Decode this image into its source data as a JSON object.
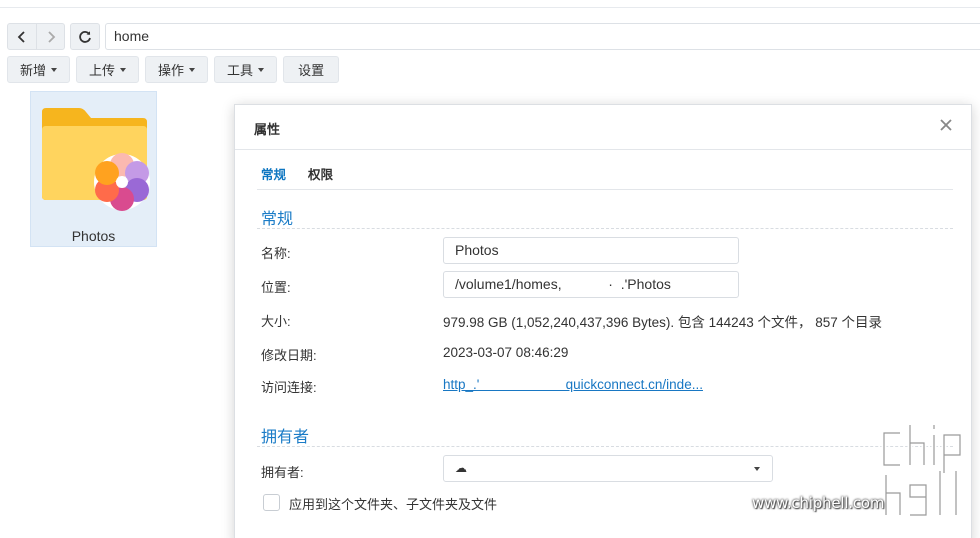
{
  "address": {
    "path": "home"
  },
  "toolbar": {
    "buttons": [
      {
        "label": "新增",
        "dropdown": true
      },
      {
        "label": "上传",
        "dropdown": true
      },
      {
        "label": "操作",
        "dropdown": true
      },
      {
        "label": "工具",
        "dropdown": true
      },
      {
        "label": "设置",
        "dropdown": false
      }
    ]
  },
  "files": [
    {
      "name": "Photos",
      "icon": "photos-folder-icon"
    }
  ],
  "dialog": {
    "title": "属性",
    "tabs": [
      "常规",
      "权限"
    ],
    "active_tab": "常规",
    "general": {
      "section_title": "常规",
      "name_label": "名称:",
      "name_value": "Photos",
      "location_label": "位置:",
      "location_value": "/volume1/homes,            ·  .'Photos",
      "size_label": "大小:",
      "size_value": "979.98 GB (1,052,240,437,396 Bytes). 包含 144243 个文件， 857 个目录",
      "modified_label": "修改日期:",
      "modified_value": "2023-03-07 08:46:29",
      "link_label": "访问连接:",
      "link_value": "http_.'                       quickconnect.cn/inde..."
    },
    "owner": {
      "section_title": "拥有者",
      "owner_label": "拥有者:",
      "owner_value": "☁",
      "apply_label": "应用到这个文件夹、子文件夹及文件"
    }
  },
  "watermark": {
    "logo_text": "chiphell",
    "url": "www.chiphell.com"
  },
  "colors": {
    "accent": "#1b7cc7",
    "selection": "#e4eef8",
    "folder": "#ffc33d"
  }
}
